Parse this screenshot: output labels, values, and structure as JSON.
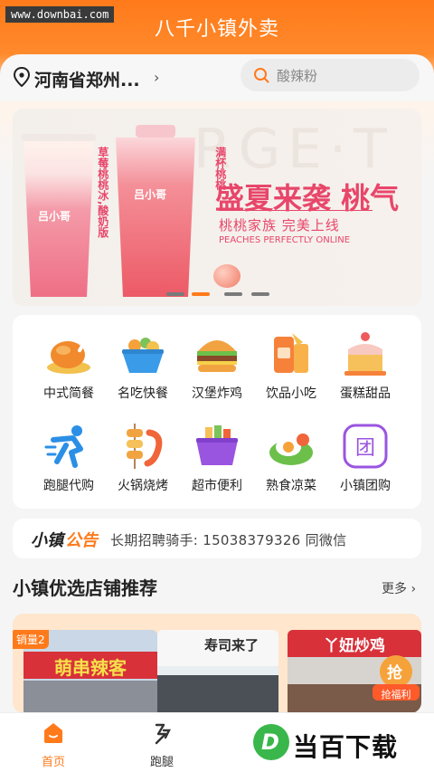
{
  "watermark": "www.downbai.com",
  "app_title": "八千小镇外卖",
  "location": {
    "text": "河南省郑州...",
    "chevron": "›"
  },
  "search": {
    "placeholder": "酸辣粉"
  },
  "banner": {
    "bg_text": "RGE·T",
    "headline": "盛夏来袭  桃气",
    "subline": "桃桃家族  完美上线",
    "subline_en": "PEACHES PERFECTLY ONLINE",
    "cup1_text": "草莓桃桃冰,酸奶版",
    "cup2_text": "满杯桃桃",
    "brand": "吕小哥",
    "dots": 4,
    "active_dot": 2
  },
  "categories": [
    {
      "label": "中式简餐",
      "icon": "roast-chicken-icon"
    },
    {
      "label": "名吃快餐",
      "icon": "food-bowl-icon"
    },
    {
      "label": "汉堡炸鸡",
      "icon": "burger-icon"
    },
    {
      "label": "饮品小吃",
      "icon": "drinks-icon"
    },
    {
      "label": "蛋糕甜品",
      "icon": "cake-icon"
    },
    {
      "label": "跑腿代购",
      "icon": "runner-icon"
    },
    {
      "label": "火锅烧烤",
      "icon": "skewer-icon"
    },
    {
      "label": "超市便利",
      "icon": "basket-icon"
    },
    {
      "label": "熟食凉菜",
      "icon": "egg-plate-icon"
    },
    {
      "label": "小镇团购",
      "icon": "group-buy-icon"
    }
  ],
  "group_buy_glyph": "团",
  "notice": {
    "tag_part1": "小镇",
    "tag_part2": "公告",
    "text": "长期招聘骑手: 15038379326 同微信"
  },
  "section": {
    "title": "小镇优选店铺推荐",
    "more": "更多 ›"
  },
  "shops": [
    {
      "sign": "萌串辣客",
      "badge": "销量2"
    },
    {
      "sign": "寿司来了"
    },
    {
      "sign": "丫妞炒鸡"
    }
  ],
  "grab_badge": {
    "glyph": "抢",
    "label": "抢福利"
  },
  "tabs": [
    {
      "label": "首页",
      "active": true
    },
    {
      "label": "跑腿",
      "active": false
    }
  ],
  "logo": {
    "mark": "D",
    "text": "当百下载"
  },
  "colors": {
    "accent": "#ff7a1a",
    "banner_pink": "#e8466a",
    "logo_green": "#3ab74a"
  }
}
